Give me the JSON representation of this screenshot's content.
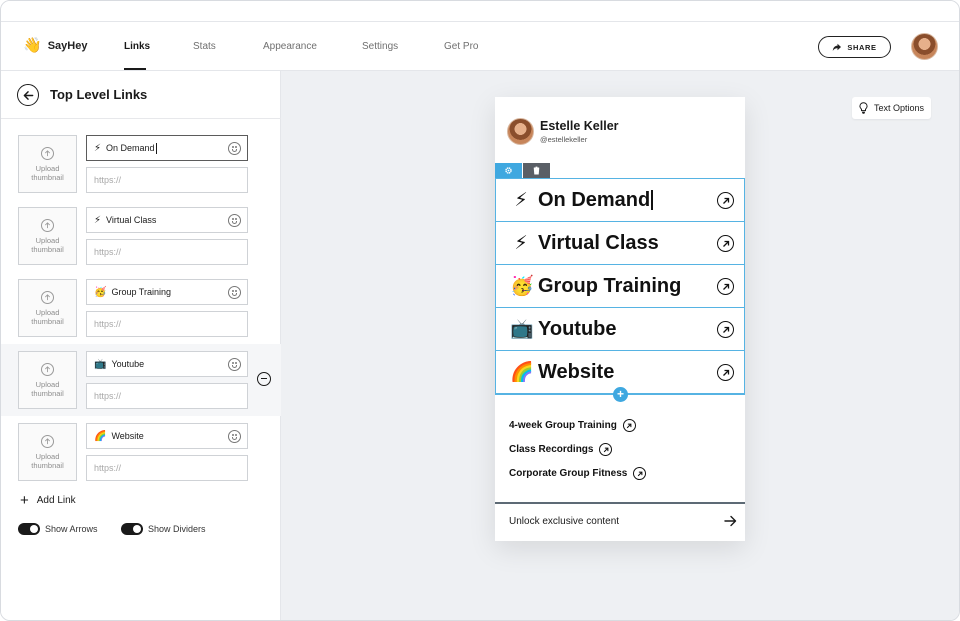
{
  "app": {
    "brand_name": "SayHey",
    "brand_icon": "👋"
  },
  "nav": {
    "items": [
      {
        "label": "Links",
        "active": true
      },
      {
        "label": "Stats",
        "active": false
      },
      {
        "label": "Appearance",
        "active": false
      },
      {
        "label": "Settings",
        "active": false
      },
      {
        "label": "Get Pro",
        "active": false
      }
    ],
    "share_label": "SHARE"
  },
  "sidebar": {
    "title": "Top Level Links",
    "thumbnail_label": "Upload thumbnail",
    "url_placeholder": "https://",
    "links": [
      {
        "emoji": "⚡",
        "title": "On Demand",
        "url": ""
      },
      {
        "emoji": "⚡",
        "title": "Virtual Class",
        "url": ""
      },
      {
        "emoji": "🥳",
        "title": "Group Training",
        "url": ""
      },
      {
        "emoji": "📺",
        "title": "Youtube",
        "url": ""
      },
      {
        "emoji": "🌈",
        "title": "Website",
        "url": ""
      }
    ],
    "add_link_label": "Add Link",
    "toggles": [
      {
        "label": "Show Arrows",
        "on": true
      },
      {
        "label": "Show Dividers",
        "on": true
      }
    ]
  },
  "canvas": {
    "text_options_label": "Text Options"
  },
  "preview": {
    "name": "Estelle Keller",
    "handle": "@estellekeller",
    "big_links": [
      {
        "emoji": "⚡",
        "title": "On Demand"
      },
      {
        "emoji": "⚡",
        "title": "Virtual Class"
      },
      {
        "emoji": "🥳",
        "title": "Group Training"
      },
      {
        "emoji": "📺",
        "title": "Youtube"
      },
      {
        "emoji": "🌈",
        "title": "Website"
      }
    ],
    "small_links": [
      {
        "title": "4-week Group Training"
      },
      {
        "title": "Class Recordings"
      },
      {
        "title": "Corporate Group Fitness"
      }
    ],
    "footer_label": "Unlock exclusive content"
  },
  "colors": {
    "accent": "#3fa8e0",
    "canvas_bg": "#eef0f3",
    "text": "#1a1a1a"
  }
}
